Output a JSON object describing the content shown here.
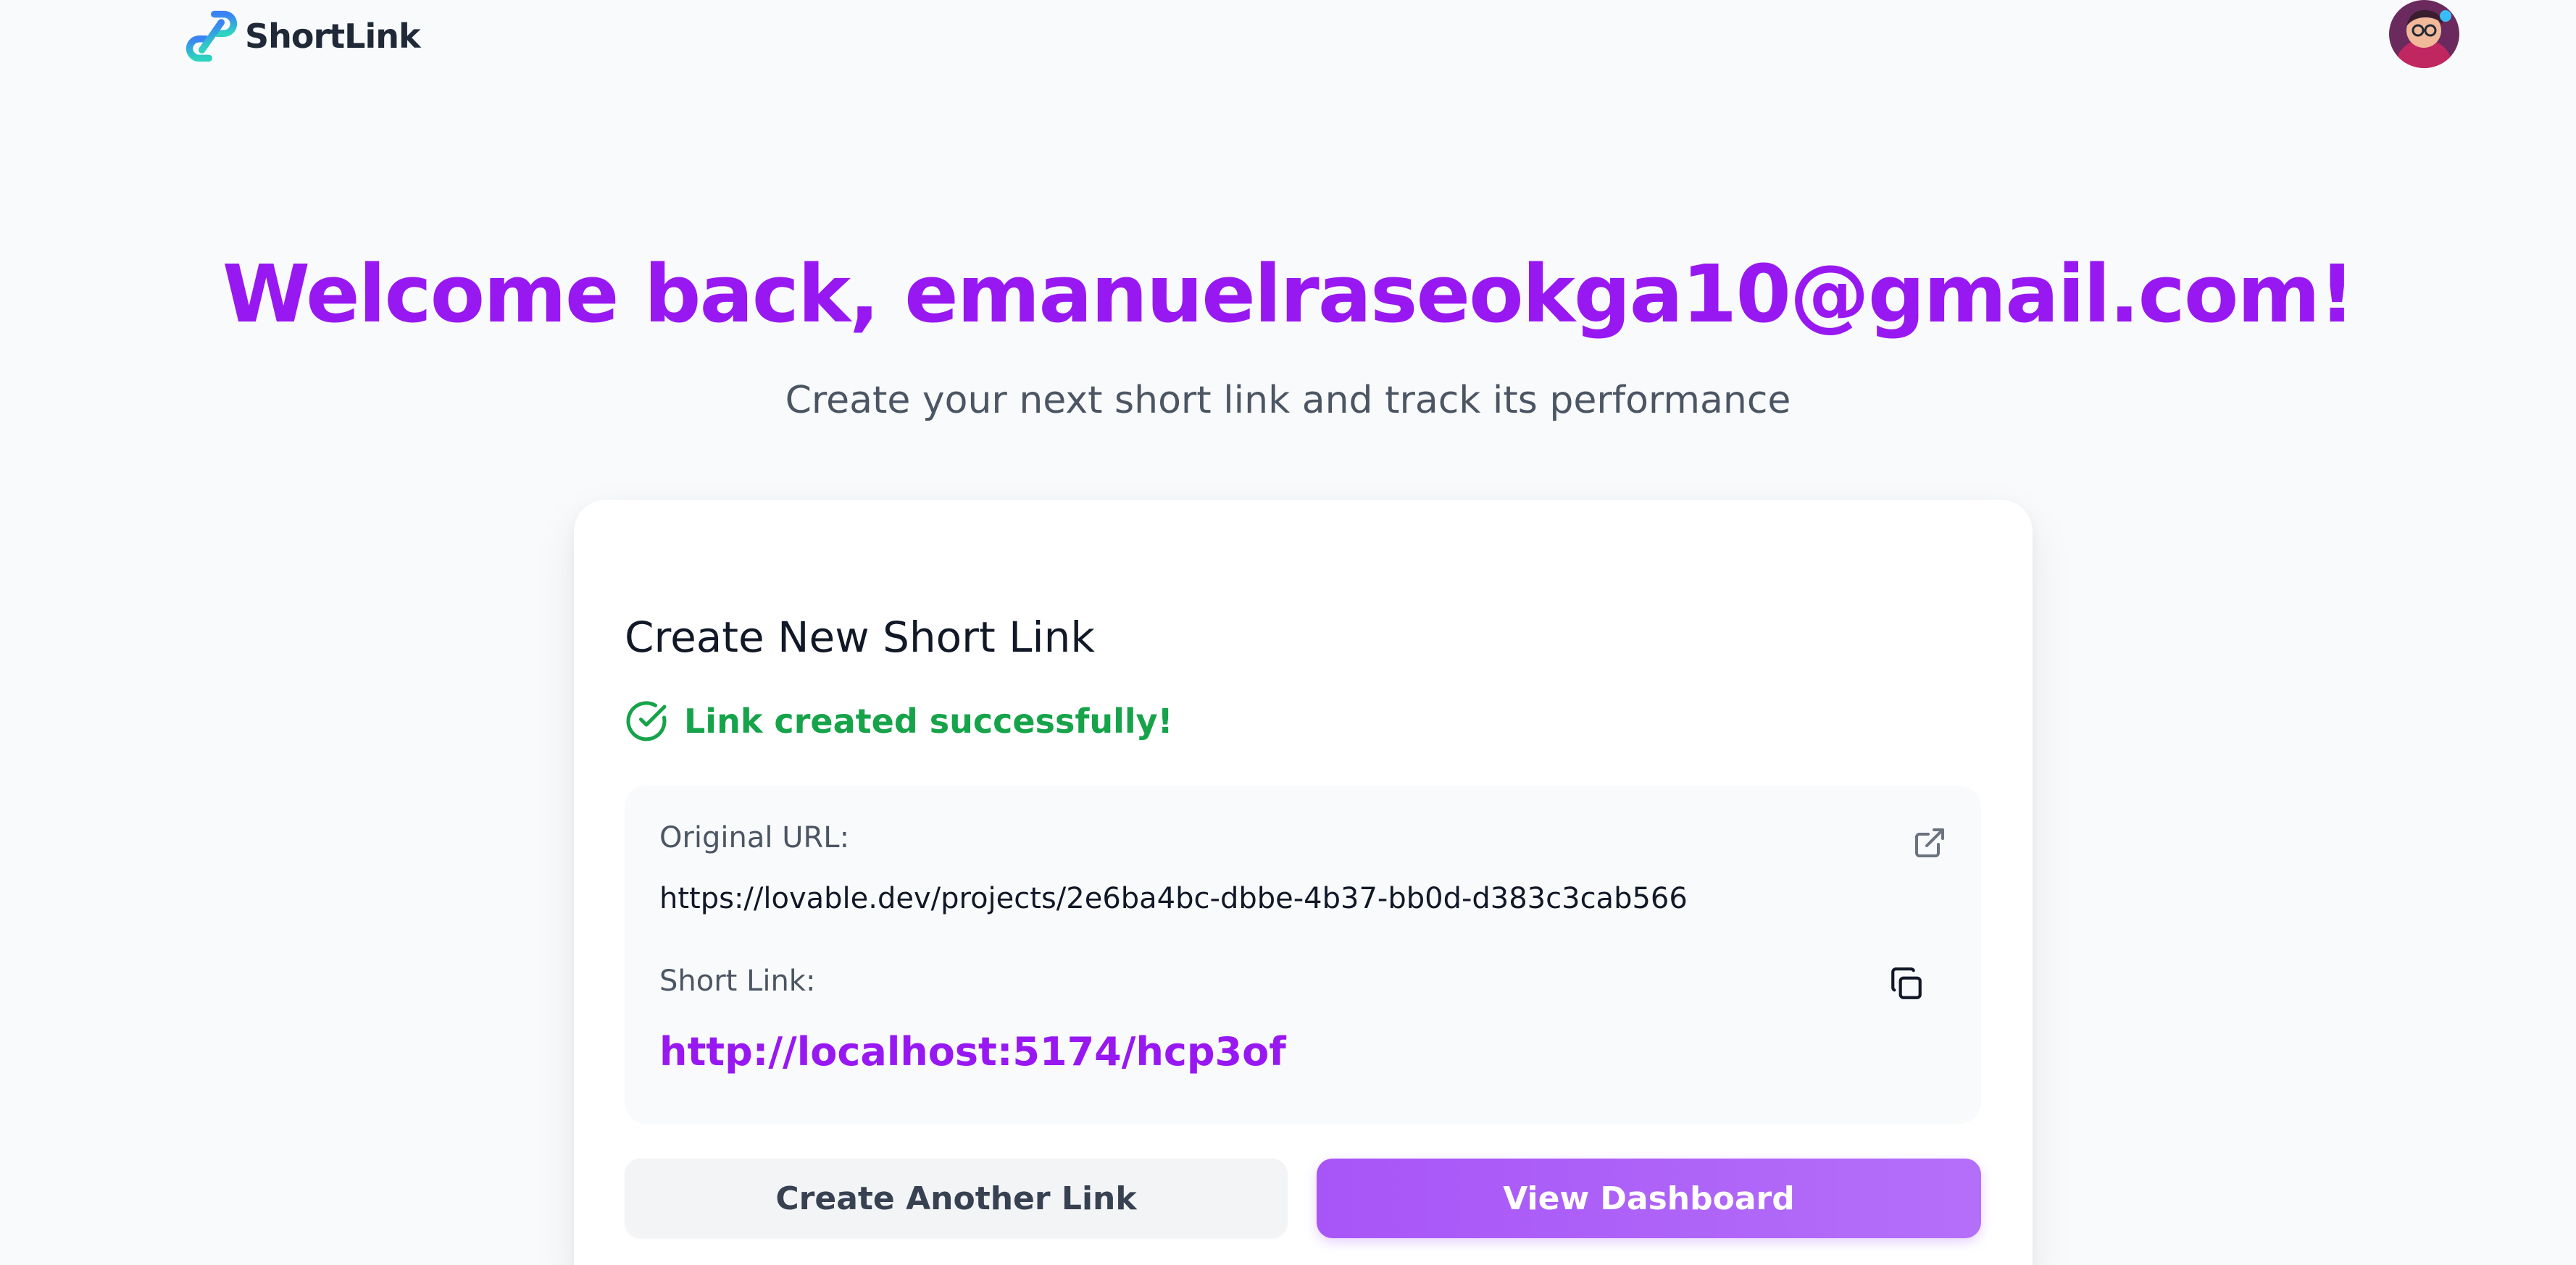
{
  "header": {
    "logo_text": "ShortLink",
    "logo_icon": "link-icon",
    "avatar_icon": "user-avatar"
  },
  "hero": {
    "welcome": "Welcome back, emanuelraseokga10@gmail.com!",
    "subtitle": "Create your next short link and track its performance"
  },
  "card": {
    "title": "Create New Short Link",
    "success_message": "Link created successfully!",
    "success_icon": "check-circle-icon",
    "original_label": "Original URL:",
    "original_url": "https://lovable.dev/projects/2e6ba4bc-dbbe-4b37-bb0d-d383c3cab566",
    "short_label": "Short Link:",
    "short_url": "http://localhost:5174/hcp3of",
    "external_icon": "external-link-icon",
    "copy_icon": "copy-icon"
  },
  "actions": {
    "create_another": "Create Another Link",
    "view_dashboard": "View Dashboard"
  },
  "colors": {
    "brand_purple": "#9818f2",
    "success_green": "#16a34a",
    "button_purple": "#a855f7",
    "logo_gradient_start": "#3b82f6",
    "logo_gradient_end": "#2dd4bf"
  }
}
